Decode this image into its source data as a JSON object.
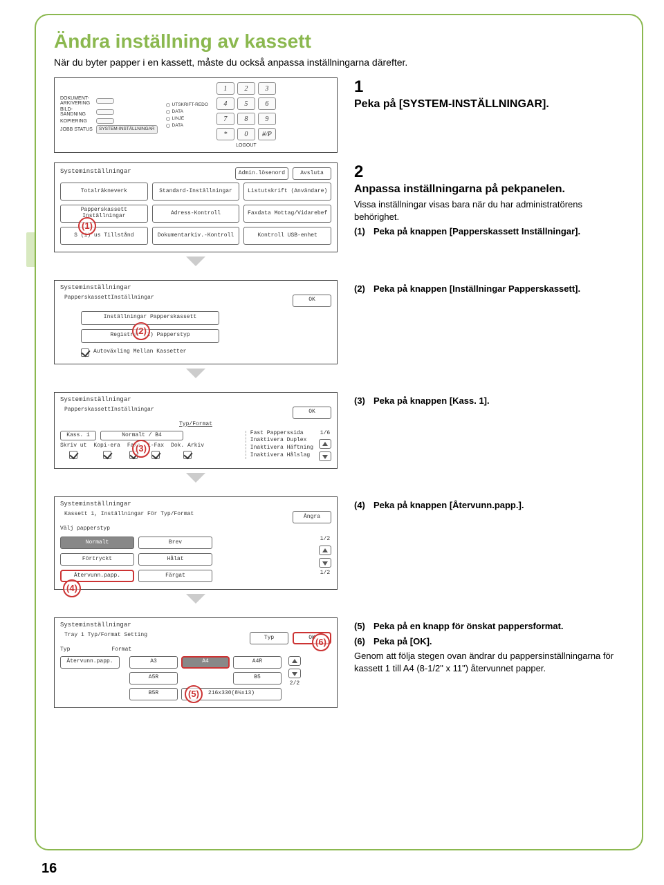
{
  "page": {
    "title": "Ändra inställning av kassett",
    "intro": "När du byter papper i en kassett, måste du också anpassa inställningarna därefter.",
    "number": "16"
  },
  "keypad": {
    "labels": {
      "dokarkiv": "DOKUMENT-ARKIVERING",
      "bild": "BILD-SANDNING",
      "kopi": "KOPIERING",
      "jobb": "JOBB STATUS",
      "utskrift": "UTSKRIFT-REDO",
      "data1": "DATA",
      "linje": "LINJE",
      "data2": "DATA",
      "system": "SYSTEM-INSTÄLLNINGAR",
      "logout": "LOGOUT"
    },
    "keys": [
      "1",
      "2",
      "3",
      "4",
      "5",
      "6",
      "7",
      "8",
      "9",
      "*",
      "0",
      "#/P"
    ]
  },
  "screen1": {
    "title": "Systeminställningar",
    "admin": "Admin.lösenord",
    "avsluta": "Avsluta",
    "buttons": {
      "r0c0": "Totalräkneverk",
      "r0c1": "Standard-Inställningar",
      "r0c2": "Listutskrift (Användare)",
      "r1c0": "Papperskassett Inställningar",
      "r1c1": "Adress-Kontroll",
      "r1c2": "Faxdata Mottag/Vidarebef",
      "r2c0": "S (1) us Tillstånd",
      "r2c1": "Dokumentarkiv.-Kontroll",
      "r2c2": "Kontroll USB-enhet"
    }
  },
  "screen2": {
    "title": "Systeminställningar",
    "sub": "PapperskassettInställningar",
    "ok": "OK",
    "insta": "Inställningar Papperskassett",
    "reg": "Registrer (2) Papperstyp",
    "auto": "Autoväxling Mellan Kassetter"
  },
  "screen3": {
    "title": "Systeminställningar",
    "sub": "PapperskassettInställningar",
    "ok": "OK",
    "typfmt": "Typ/Format",
    "kass": "Kass. 1",
    "paper": "Normalt / B4",
    "cols": {
      "skriv": "Skriv ut",
      "kopi": "Kopi-era",
      "faxa": "Faxa",
      "ifax": "i-Fax",
      "dok": "Dok. Arkiv"
    },
    "side": {
      "fast": "Fast Papperssida",
      "dup": "Inaktivera Duplex",
      "haft": "Inaktivera Häftning",
      "hal": "Inaktivera Hålslag"
    },
    "page": "1/6"
  },
  "screen4": {
    "title": "Systeminställningar",
    "sub": "Kassett 1, Inställningar För Typ/Format",
    "angra": "Ångra",
    "valj": "Välj papperstyp",
    "page_a": "1/2",
    "page_b": "1/2",
    "buttons": {
      "normalt": "Normalt",
      "brev": "Brev",
      "fortryckt": "Förtryckt",
      "halat": "Hålat",
      "atervunn": "Återvunn.papp.",
      "fargat": "Färgat"
    }
  },
  "screen5": {
    "title": "Systeminställningar",
    "sub": "Tray 1 Typ/Format Setting",
    "typ_hdr": "Typ",
    "fmt_hdr": "Format",
    "typ_btn": "Typ",
    "ok": "OK",
    "atervunn": "Återvunn.papp.",
    "sizes": {
      "a3": "A3",
      "a4": "A4",
      "a4r": "A4R",
      "a5r": "A5R",
      "b5": "B5",
      "b5r": "B5R",
      "custom": "216x330(8½x13)"
    },
    "page": "2/2"
  },
  "steps": {
    "s1_num": "1",
    "s1_head": "Peka på [SYSTEM-INSTÄLLNINGAR].",
    "s2_num": "2",
    "s2_head": "Anpassa inställningarna på pekpanelen.",
    "s2_body": "Vissa inställningar visas bara när du har administratörens behörighet.",
    "s2_li1_num": "(1)",
    "s2_li1": "Peka på knappen [Papperskassett Inställningar].",
    "s2_li2_num": "(2)",
    "s2_li2": "Peka på knappen [Inställningar Papperskassett].",
    "s2_li3_num": "(3)",
    "s2_li3": "Peka på knappen [Kass. 1].",
    "s2_li4_num": "(4)",
    "s2_li4": "Peka på knappen [Återvunn.papp.].",
    "s2_li5_num": "(5)",
    "s2_li5": "Peka på en knapp för önskat pappersformat.",
    "s2_li6_num": "(6)",
    "s2_li6": "Peka på [OK].",
    "s2_tail": "Genom att följa stegen ovan ändrar du pappersinställningarna för kassett 1 till A4 (8-1/2\" x 11\") återvunnet papper."
  }
}
